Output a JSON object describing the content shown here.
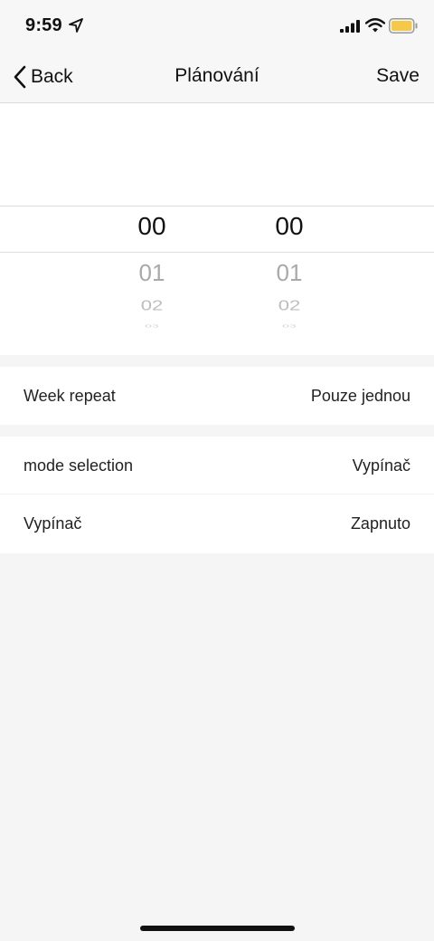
{
  "status_bar": {
    "time": "9:59",
    "icons": [
      "location-arrow-icon",
      "signal-icon",
      "wifi-icon",
      "battery-icon"
    ],
    "battery_color": "#f5c84a"
  },
  "nav": {
    "back_label": "Back",
    "title": "Plánování",
    "save_label": "Save"
  },
  "picker": {
    "hours": {
      "selected": "00",
      "next": [
        "01",
        "02",
        "03"
      ]
    },
    "minutes": {
      "selected": "00",
      "next": [
        "01",
        "02",
        "03"
      ]
    }
  },
  "settings": {
    "week_repeat": {
      "label": "Week repeat",
      "value": "Pouze jednou"
    },
    "mode_selection": {
      "label": "mode selection",
      "value": "Vypínač"
    },
    "switch": {
      "label": "Vypínač",
      "value": "Zapnuto"
    }
  }
}
